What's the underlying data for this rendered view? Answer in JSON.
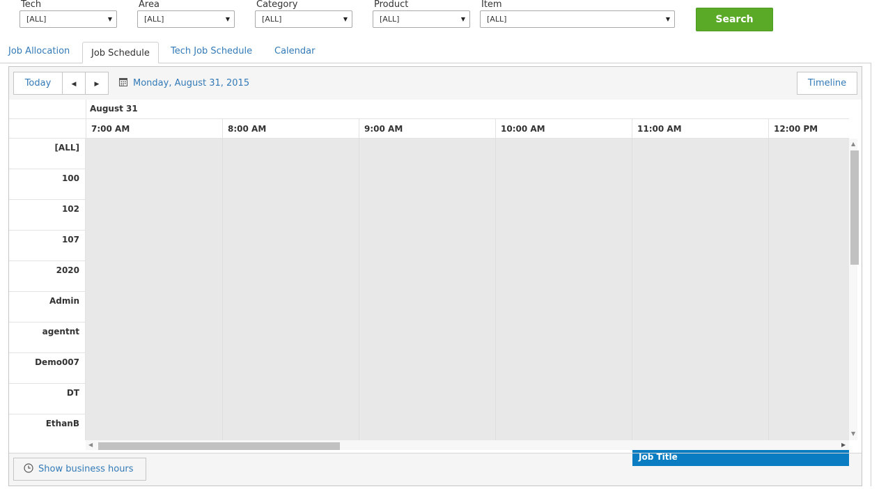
{
  "filters": [
    {
      "label": "Tech",
      "value": "[ALL]"
    },
    {
      "label": "Area",
      "value": "[ALL]"
    },
    {
      "label": "Category",
      "value": "[ALL]"
    },
    {
      "label": "Product",
      "value": "[ALL]"
    },
    {
      "label": "Item",
      "value": "[ALL]"
    }
  ],
  "search_label": "Search",
  "search_color": "#5aaa27",
  "tabs": [
    {
      "label": "Job Allocation",
      "active": false
    },
    {
      "label": "Job Schedule",
      "active": true
    },
    {
      "label": "Tech Job Schedule",
      "active": false
    },
    {
      "label": "Calendar",
      "active": false
    }
  ],
  "toolbar": {
    "today_label": "Today",
    "prev_icon": "caret-left-icon",
    "next_icon": "caret-right-icon",
    "calendar_icon": "calendar-icon",
    "date_label": "Monday, August 31, 2015",
    "view_label": "Timeline"
  },
  "schedule": {
    "day_label": "August 31",
    "times": [
      "7:00 AM",
      "8:00 AM",
      "9:00 AM",
      "10:00 AM",
      "11:00 AM",
      "12:00 PM"
    ],
    "resources": [
      "[ALL]",
      "100",
      "102",
      "107",
      "2020",
      "Admin",
      "agentnt",
      "Demo007",
      "DT",
      "EthanB"
    ],
    "event": {
      "title": "Job Title",
      "resource": "EthanB",
      "start": "11:00 AM",
      "color": "#0a7dc2"
    }
  },
  "footer": {
    "business_hours_label": "Show business hours",
    "icon": "clock-icon"
  }
}
